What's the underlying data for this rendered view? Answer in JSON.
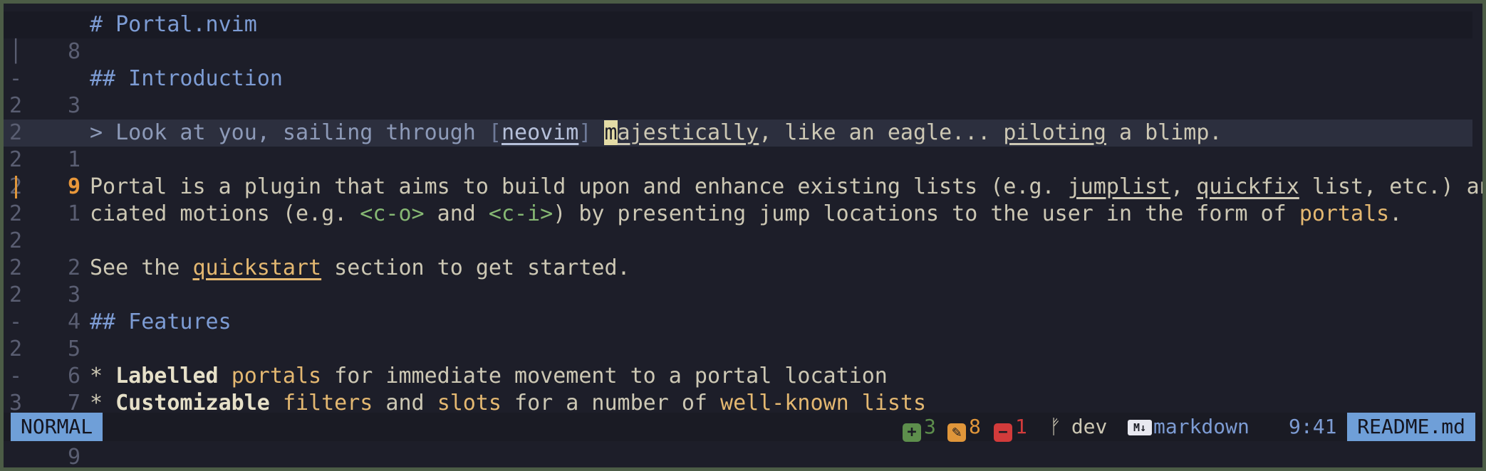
{
  "editor": {
    "fold_mark": "│",
    "lines": {
      "l1": {
        "fold": "",
        "num": "8",
        "text": "# Portal.nvim"
      },
      "l2": {
        "fold": "│",
        "num": "3"
      },
      "l3": {
        "fold": "-",
        "num": "2",
        "text": "## Introduction"
      },
      "l4": {
        "fold": "2",
        "num": "1"
      },
      "l5": {
        "fold": "2",
        "num": "9",
        "q1": "> Look at you, sailing through ",
        "b1": "[",
        "link": "neovim",
        "b2": "]",
        "sp": " ",
        "cursor_char": "m",
        "w1": "ajestically",
        "t2": ", like an eagle... ",
        "w2": "piloting",
        "t3": " a blimp."
      },
      "l6": {
        "fold": "2",
        "num": "1"
      },
      "l7": {
        "fold": "2",
        "num": "2",
        "t1": "Portal is a plugin that aims to build upon and enhance existing lists (e.g. ",
        "w1": "jumplist",
        "t2": ", ",
        "w2": "quickfix",
        "t3": " list, etc.) and their asso"
      },
      "l8": {
        "fold": "2",
        "t1": "ciated motions (e.g. ",
        "c1": "<c-o>",
        "t2": " and ",
        "c2": "<c-i>",
        "t3": ") by presenting jump locations to the user in the form of ",
        "a1": "portals",
        "t4": "."
      },
      "l9": {
        "fold": "2",
        "num": "3"
      },
      "l10": {
        "fold": "2",
        "num": "4",
        "t1": "See the ",
        "w1": "quickstart",
        "t2": " section to get started."
      },
      "l11": {
        "fold": "2",
        "num": "5"
      },
      "l12": {
        "fold": "-",
        "num": "6",
        "text": "## Features"
      },
      "l13": {
        "fold": "2",
        "num": "7"
      },
      "l14": {
        "fold": "-",
        "num": "8",
        "t1": "* ",
        "b1": "Labelled",
        "t2": " ",
        "a1": "portals",
        "t3": " for immediate movement to a portal location"
      },
      "l15": {
        "fold": "3",
        "num": "9",
        "t1": "* ",
        "b1": "Customizable",
        "t2": " ",
        "a1": "filters",
        "t3": " and ",
        "a2": "slots",
        "t4": " for a number of ",
        "a3": "well-known lists"
      }
    }
  },
  "statusbar": {
    "mode": "NORMAL",
    "added_icon": "+",
    "added": "3",
    "changed_icon": "✎",
    "changed": "8",
    "removed_icon": "−",
    "removed": "1",
    "branch_icon": "ᚠ",
    "branch": "dev",
    "filetype_icon": "M↓",
    "filetype": "markdown",
    "position": "9:41",
    "filename": "README.md"
  },
  "colors": {
    "added": "#5d8e4c",
    "changed": "#e0963a",
    "removed": "#d23b3b",
    "gitbar": "#e0963a",
    "mode_bg": "#6f9fd8",
    "heading": "#7d9cd4",
    "accent": "#e4b871"
  }
}
